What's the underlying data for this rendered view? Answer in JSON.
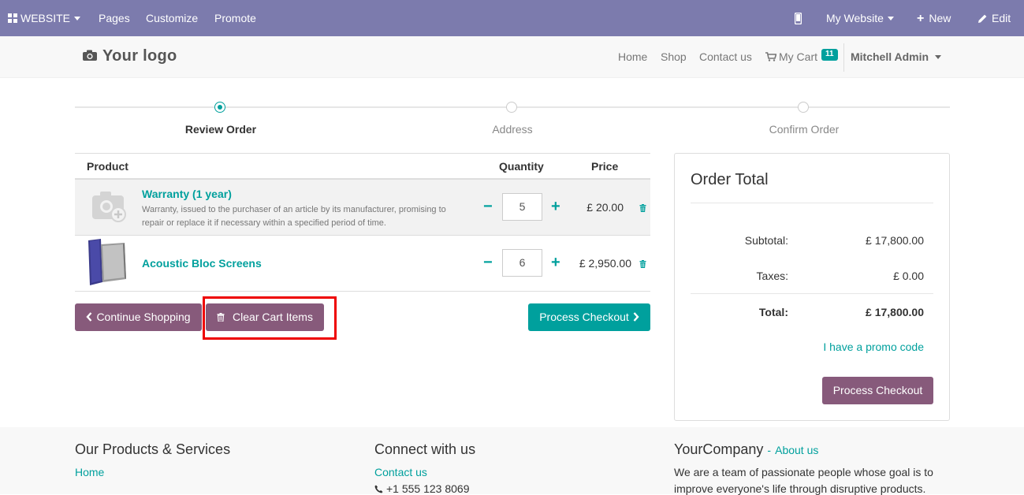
{
  "adminbar": {
    "website_label": "WEBSITE",
    "pages_label": "Pages",
    "customize_label": "Customize",
    "promote_label": "Promote",
    "my_website_label": "My Website",
    "new_label": "New",
    "edit_label": "Edit",
    "bg_color": "#7c7bad"
  },
  "header": {
    "logo_text": "Your logo",
    "nav": {
      "home": "Home",
      "shop": "Shop",
      "contact": "Contact us",
      "cart": "My Cart",
      "cart_count": "11"
    },
    "user_name": "Mitchell Admin"
  },
  "wizard": {
    "steps": [
      {
        "label": "Review Order",
        "active": true
      },
      {
        "label": "Address",
        "active": false
      },
      {
        "label": "Confirm Order",
        "active": false
      }
    ]
  },
  "cart": {
    "headers": {
      "product": "Product",
      "quantity": "Quantity",
      "price": "Price"
    },
    "lines": [
      {
        "name": "Warranty (1 year)",
        "description": "Warranty, issued to the purchaser of an article by its manufacturer, promising to repair or replace it if necessary within a specified period of time.",
        "quantity": "5",
        "price": "£ 20.00"
      },
      {
        "name": "Acoustic Bloc Screens",
        "description": "",
        "quantity": "6",
        "price": "£ 2,950.00"
      }
    ],
    "minus_symbol": "−",
    "plus_symbol": "+",
    "continue_label": "Continue Shopping",
    "clear_label": "Clear Cart Items",
    "checkout_label": "Process Checkout"
  },
  "order_total": {
    "title": "Order Total",
    "subtotal_label": "Subtotal:",
    "subtotal_value": "£ 17,800.00",
    "taxes_label": "Taxes:",
    "taxes_value": "£ 0.00",
    "total_label": "Total:",
    "total_value": "£ 17,800.00",
    "promo_label": "I have a promo code",
    "checkout_label": "Process Checkout"
  },
  "footer": {
    "col1_title": "Our Products & Services",
    "col1_link": "Home",
    "col2_title": "Connect with us",
    "col2_link": "Contact us",
    "col2_phone": "+1 555 123 8069",
    "col3_title": "YourCompany",
    "col3_sep": "-",
    "col3_link": "About us",
    "col3_text_1": "We are a team of passionate people whose goal is to",
    "col3_text_2": "improve everyone's life through disruptive products."
  },
  "colors": {
    "accent_teal": "#00a09d",
    "accent_purple": "#875a7b",
    "highlight_red": "#ee0000"
  }
}
